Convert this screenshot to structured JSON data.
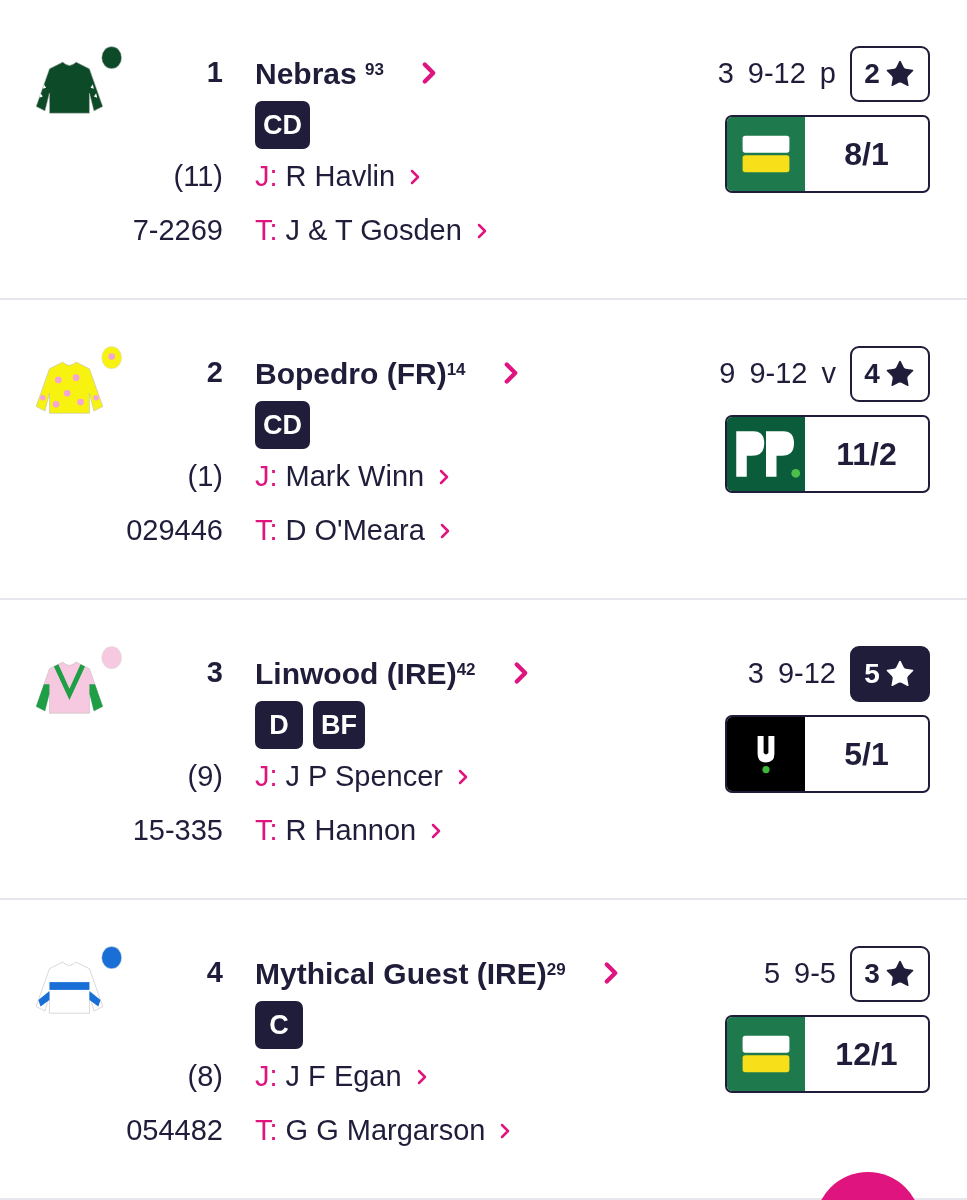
{
  "runners": [
    {
      "number": "1",
      "name": "Nebras $^{93}$",
      "tags": [
        "CD"
      ],
      "draw": "(11)",
      "form": "7-2269",
      "jockey_prefix": "J:",
      "jockey": "R Havlin",
      "trainer_prefix": "T:",
      "trainer": "J & T Gosden",
      "age": "3",
      "weight": "9-12",
      "headgear": "p",
      "star_rating": "2",
      "highlighted": false,
      "bookmaker": {
        "kind": "bet365",
        "odds": "8/1"
      },
      "silk": {
        "kind": "stars-sleeves",
        "color": "#0d4a27"
      }
    },
    {
      "number": "2",
      "name": "Bopedro (FR)$^{14}$",
      "tags": [
        "CD"
      ],
      "draw": "(1)",
      "form": "029446",
      "jockey_prefix": "J:",
      "jockey": "Mark Winn",
      "trainer_prefix": "T:",
      "trainer": "D O'Meara",
      "age": "9",
      "weight": "9-12",
      "headgear": "v",
      "star_rating": "4",
      "highlighted": false,
      "bookmaker": {
        "kind": "paddypower",
        "odds": "11/2"
      },
      "silk": {
        "kind": "spots",
        "color": "#f7f20f"
      }
    },
    {
      "number": "3",
      "name": "Linwood (IRE)$^{42}$",
      "tags": [
        "D",
        "BF"
      ],
      "draw": "(9)",
      "form": "15-335",
      "jockey_prefix": "J:",
      "jockey": "J P Spencer",
      "trainer_prefix": "T:",
      "trainer": "R Hannon",
      "age": "3",
      "weight": "9-12",
      "star_rating": "5",
      "highlighted": true,
      "bookmaker": {
        "kind": "unibet",
        "odds": "5/1"
      },
      "silk": {
        "kind": "chevron-sleeves",
        "color": "#f6c9e0"
      }
    },
    {
      "number": "4",
      "name": "Mythical Guest (IRE)$^{29}$",
      "tags": [
        "C"
      ],
      "draw": "(8)",
      "form": "054482",
      "jockey_prefix": "J:",
      "jockey": "J F Egan",
      "trainer_prefix": "T:",
      "trainer": "G G Margarson",
      "age": "5",
      "weight": "9-5",
      "star_rating": "3",
      "highlighted": false,
      "bookmaker": {
        "kind": "bet365",
        "odds": "12/1"
      },
      "silk": {
        "kind": "hoop-sleeves",
        "color": "#ffffff"
      }
    }
  ]
}
